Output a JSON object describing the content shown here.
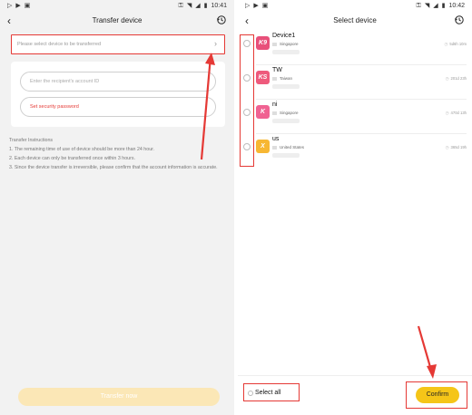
{
  "left_screen": {
    "status": {
      "time": "10:41"
    },
    "title": "Transfer device",
    "device_select_placeholder": "Please select device to be transferred",
    "account_placeholder": "Enter the recipient's account ID",
    "password_label": "Set security password",
    "instructions": {
      "heading": "Transfer Instructions",
      "items": [
        "1. The remaining time of use of device should be more than 24 hour.",
        "2. Each device can only be transferred once within 3 hours.",
        "3. Since the device transfer is irreversible, please confirm that the account information is accurate."
      ]
    },
    "transfer_button": "Transfer now"
  },
  "right_screen": {
    "status": {
      "time": "10:42"
    },
    "title": "Select device",
    "devices": [
      {
        "name": "Device1",
        "logo": "K9",
        "logo_color": "#e8507a",
        "region": "Singapore",
        "remaining": "5d6h 10m"
      },
      {
        "name": "TW",
        "logo": "KS",
        "logo_color": "#ee5a7c",
        "region": "Taiwan",
        "remaining": "201d 23h"
      },
      {
        "name": "ni",
        "logo": "K",
        "logo_color": "#f06292",
        "region": "Singapore",
        "remaining": "470d 13h"
      },
      {
        "name": "us",
        "logo": "X",
        "logo_color": "#f7b733",
        "region": "United States",
        "remaining": "365d 19h"
      }
    ],
    "select_all": "Select all",
    "confirm_button": "Confirm"
  },
  "colors": {
    "accent_red": "#e53935",
    "confirm_yellow": "#f5c518",
    "disabled_yellow": "#fbe7b6"
  },
  "icons": {
    "back": "chevron-left-icon",
    "history": "history-icon",
    "chevron": "chevron-right-icon",
    "clock": "clock-icon"
  }
}
